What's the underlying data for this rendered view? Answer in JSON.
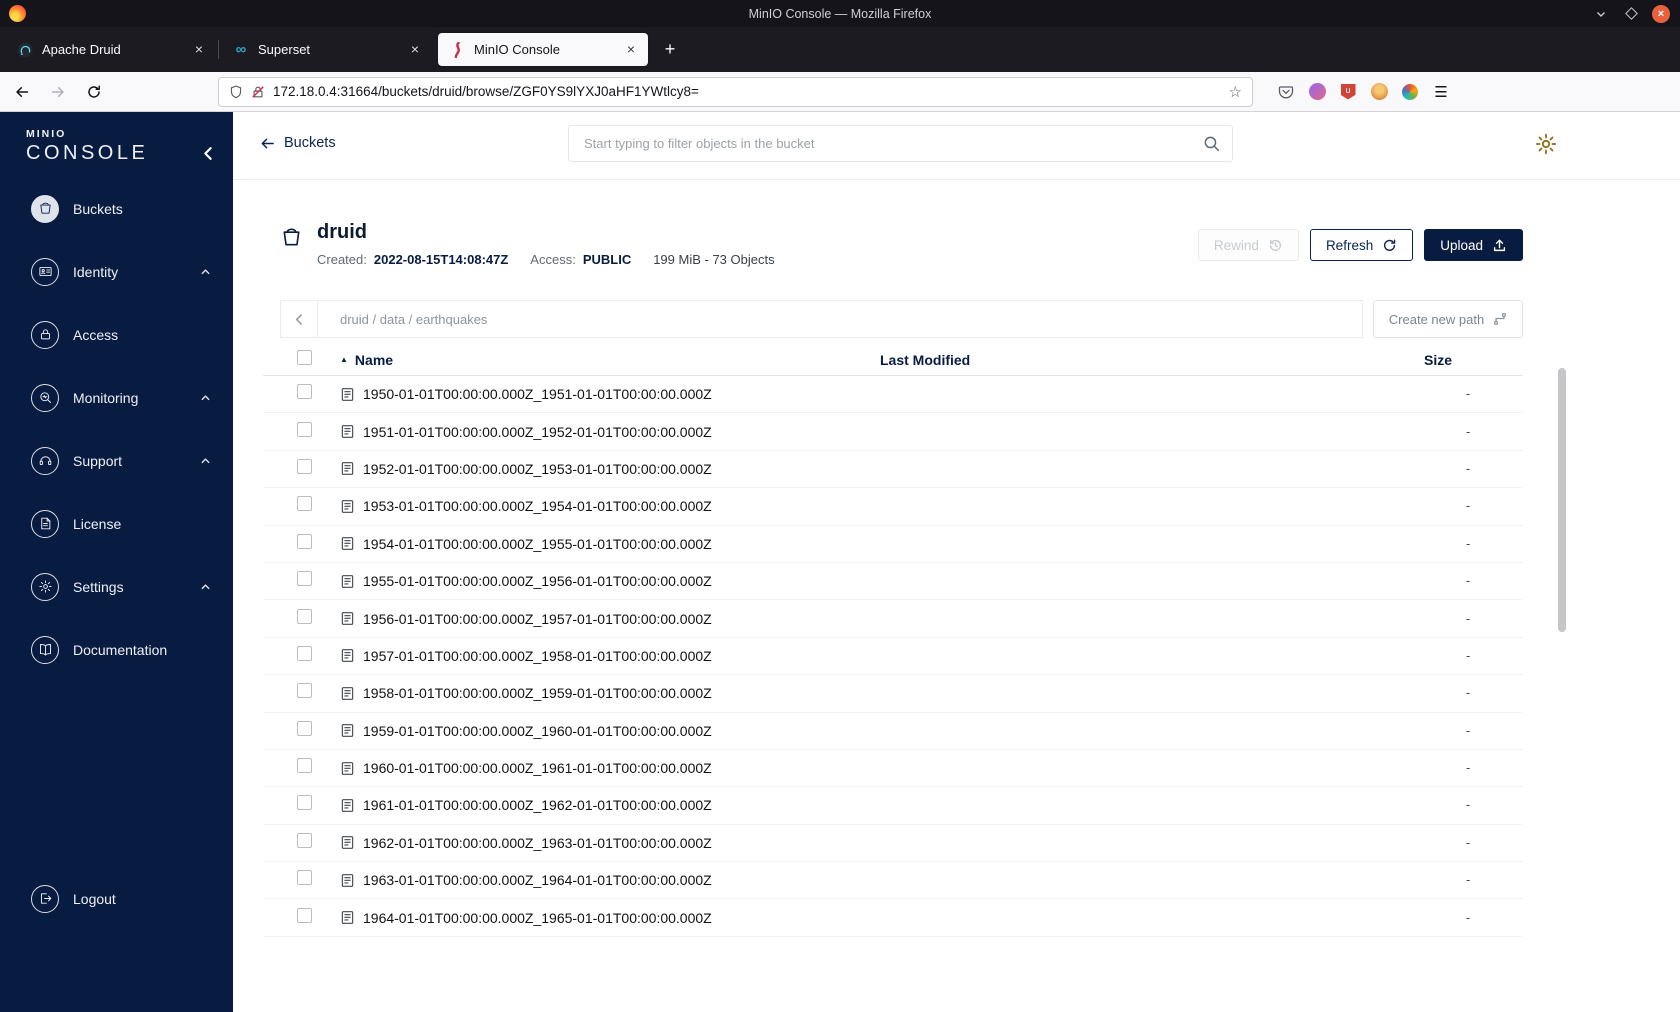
{
  "window": {
    "title": "MinIO Console — Mozilla Firefox"
  },
  "glyphs": {
    "close_tab": "×",
    "new_tab": "+",
    "menu": "☰",
    "star": "☆",
    "sort_asc": "▲",
    "superset_logo": "∞",
    "close_window": "×"
  },
  "browser": {
    "tabs": [
      {
        "label": "Apache Druid"
      },
      {
        "label": "Superset"
      },
      {
        "label": "MinIO Console",
        "active": true
      }
    ],
    "url": "172.18.0.4:31664/buckets/druid/browse/ZGF0YS9lYXJ0aHF1YWtlcy8="
  },
  "sidebar": {
    "logo_top": "MINIO",
    "logo_bottom": "CONSOLE",
    "items": [
      {
        "label": "Buckets",
        "icon": "buckets-icon",
        "active": true
      },
      {
        "label": "Identity",
        "icon": "identity-icon",
        "expandable": true
      },
      {
        "label": "Access",
        "icon": "access-icon"
      },
      {
        "label": "Monitoring",
        "icon": "monitoring-icon",
        "expandable": true
      },
      {
        "label": "Support",
        "icon": "support-icon",
        "expandable": true
      },
      {
        "label": "License",
        "icon": "license-icon"
      },
      {
        "label": "Settings",
        "icon": "settings-icon",
        "expandable": true
      },
      {
        "label": "Documentation",
        "icon": "documentation-icon"
      }
    ],
    "logout_label": "Logout"
  },
  "header": {
    "back_label": "Buckets",
    "search_placeholder": "Start typing to filter objects in the bucket"
  },
  "bucket": {
    "name": "druid",
    "created_label": "Created:",
    "created_value": "2022-08-15T14:08:47Z",
    "access_label": "Access:",
    "access_value": "PUBLIC",
    "stats": "199 MiB - 73 Objects",
    "rewind_label": "Rewind",
    "refresh_label": "Refresh",
    "upload_label": "Upload"
  },
  "browse": {
    "breadcrumb": "druid / data / earthquakes",
    "create_path_label": "Create new path"
  },
  "table": {
    "name_header": "Name",
    "last_modified_header": "Last Modified",
    "size_header": "Size",
    "rows": [
      {
        "name": "1950-01-01T00:00:00.000Z_1951-01-01T00:00:00.000Z",
        "size": "-"
      },
      {
        "name": "1951-01-01T00:00:00.000Z_1952-01-01T00:00:00.000Z",
        "size": "-"
      },
      {
        "name": "1952-01-01T00:00:00.000Z_1953-01-01T00:00:00.000Z",
        "size": "-"
      },
      {
        "name": "1953-01-01T00:00:00.000Z_1954-01-01T00:00:00.000Z",
        "size": "-"
      },
      {
        "name": "1954-01-01T00:00:00.000Z_1955-01-01T00:00:00.000Z",
        "size": "-"
      },
      {
        "name": "1955-01-01T00:00:00.000Z_1956-01-01T00:00:00.000Z",
        "size": "-"
      },
      {
        "name": "1956-01-01T00:00:00.000Z_1957-01-01T00:00:00.000Z",
        "size": "-"
      },
      {
        "name": "1957-01-01T00:00:00.000Z_1958-01-01T00:00:00.000Z",
        "size": "-"
      },
      {
        "name": "1958-01-01T00:00:00.000Z_1959-01-01T00:00:00.000Z",
        "size": "-"
      },
      {
        "name": "1959-01-01T00:00:00.000Z_1960-01-01T00:00:00.000Z",
        "size": "-"
      },
      {
        "name": "1960-01-01T00:00:00.000Z_1961-01-01T00:00:00.000Z",
        "size": "-"
      },
      {
        "name": "1961-01-01T00:00:00.000Z_1962-01-01T00:00:00.000Z",
        "size": "-"
      },
      {
        "name": "1962-01-01T00:00:00.000Z_1963-01-01T00:00:00.000Z",
        "size": "-"
      },
      {
        "name": "1963-01-01T00:00:00.000Z_1964-01-01T00:00:00.000Z",
        "size": "-"
      },
      {
        "name": "1964-01-01T00:00:00.000Z_1965-01-01T00:00:00.000Z",
        "size": "-"
      }
    ]
  },
  "colors": {
    "sidebar_navy": "#081C42",
    "accent_red": "#C72E49",
    "gear_gold": "#8a6e15"
  }
}
